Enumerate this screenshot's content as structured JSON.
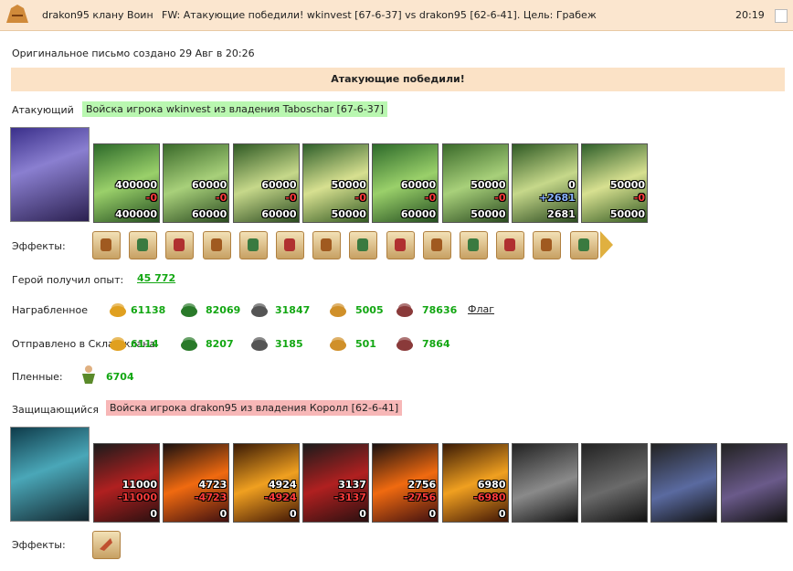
{
  "header": {
    "from": "drakon95 клану Воин",
    "subject": "FW: Атакующие победили! wkinvest [67-6-37] vs drakon95 [62-6-41]. Цель: Грабеж",
    "time": "20:19"
  },
  "created": "Оригинальное письмо создано 29 Авг в 20:26",
  "banner": "Атакующие победили!",
  "attacker": {
    "label": "Атакующий",
    "tag": "Войска игрока wkinvest из владения Taboschar [67-6-37]",
    "units": [
      {
        "n1": "400000",
        "n2": "-0",
        "n3": "400000"
      },
      {
        "n1": "60000",
        "n2": "-0",
        "n3": "60000"
      },
      {
        "n1": "60000",
        "n2": "-0",
        "n3": "60000"
      },
      {
        "n1": "50000",
        "n2": "-0",
        "n3": "50000"
      },
      {
        "n1": "60000",
        "n2": "-0",
        "n3": "60000"
      },
      {
        "n1": "50000",
        "n2": "-0",
        "n3": "50000"
      },
      {
        "n1": "0",
        "n2": "+2681",
        "n3": "2681"
      },
      {
        "n1": "50000",
        "n2": "-0",
        "n3": "50000"
      }
    ]
  },
  "effects_label": "Эффекты:",
  "exp": {
    "label": "Герой получил опыт:",
    "value": "45 772"
  },
  "loot": {
    "label": "Награбленное",
    "gold": "61138",
    "wood": "82069",
    "ore": "31847",
    "grain": "5005",
    "stone": "78636",
    "flag": "Флаг"
  },
  "sent": {
    "label": "Отправлено в Склад клана",
    "gold": "6114",
    "wood": "8207",
    "ore": "3185",
    "grain": "501",
    "stone": "7864"
  },
  "captives": {
    "label": "Пленные:",
    "value": "6704"
  },
  "defender": {
    "label": "Защищающийся",
    "tag": "Войска игрока drakon95 из владения Королл [62-6-41]",
    "units": [
      {
        "n1": "11000",
        "n2": "-11000",
        "n3": "0"
      },
      {
        "n1": "4723",
        "n2": "-4723",
        "n3": "0"
      },
      {
        "n1": "4924",
        "n2": "-4924",
        "n3": "0"
      },
      {
        "n1": "3137",
        "n2": "-3137",
        "n3": "0"
      },
      {
        "n1": "2756",
        "n2": "-2756",
        "n3": "0"
      },
      {
        "n1": "6980",
        "n2": "-6980",
        "n3": "0"
      }
    ]
  },
  "icons": {
    "logo": "helmet-icon",
    "close": "close-icon",
    "gold": "gold-coins-icon",
    "wood": "tree-icon",
    "ore": "ore-icon",
    "grain": "grain-icon",
    "stone": "stone-icon",
    "captive": "captive-icon"
  }
}
